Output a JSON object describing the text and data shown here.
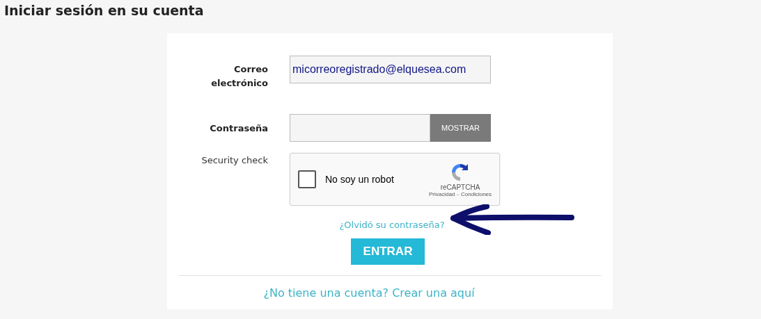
{
  "page_title": "Iniciar sesión en su cuenta",
  "email": {
    "label": "Correo electrónico",
    "value": "micorreoregistrado@elquesea.com"
  },
  "password": {
    "label": "Contraseña",
    "show_button": "MOSTRAR"
  },
  "security": {
    "label": "Security check",
    "captcha_label": "No soy un robot",
    "checked": false,
    "brand": "reCAPTCHA",
    "privacy": "Privacidad",
    "separator": "-",
    "terms": "Condiciones"
  },
  "forgot_link": "¿Olvidó su contraseña?",
  "submit": "ENTRAR",
  "register_link": "¿No tiene una cuenta? Crear una aquí"
}
